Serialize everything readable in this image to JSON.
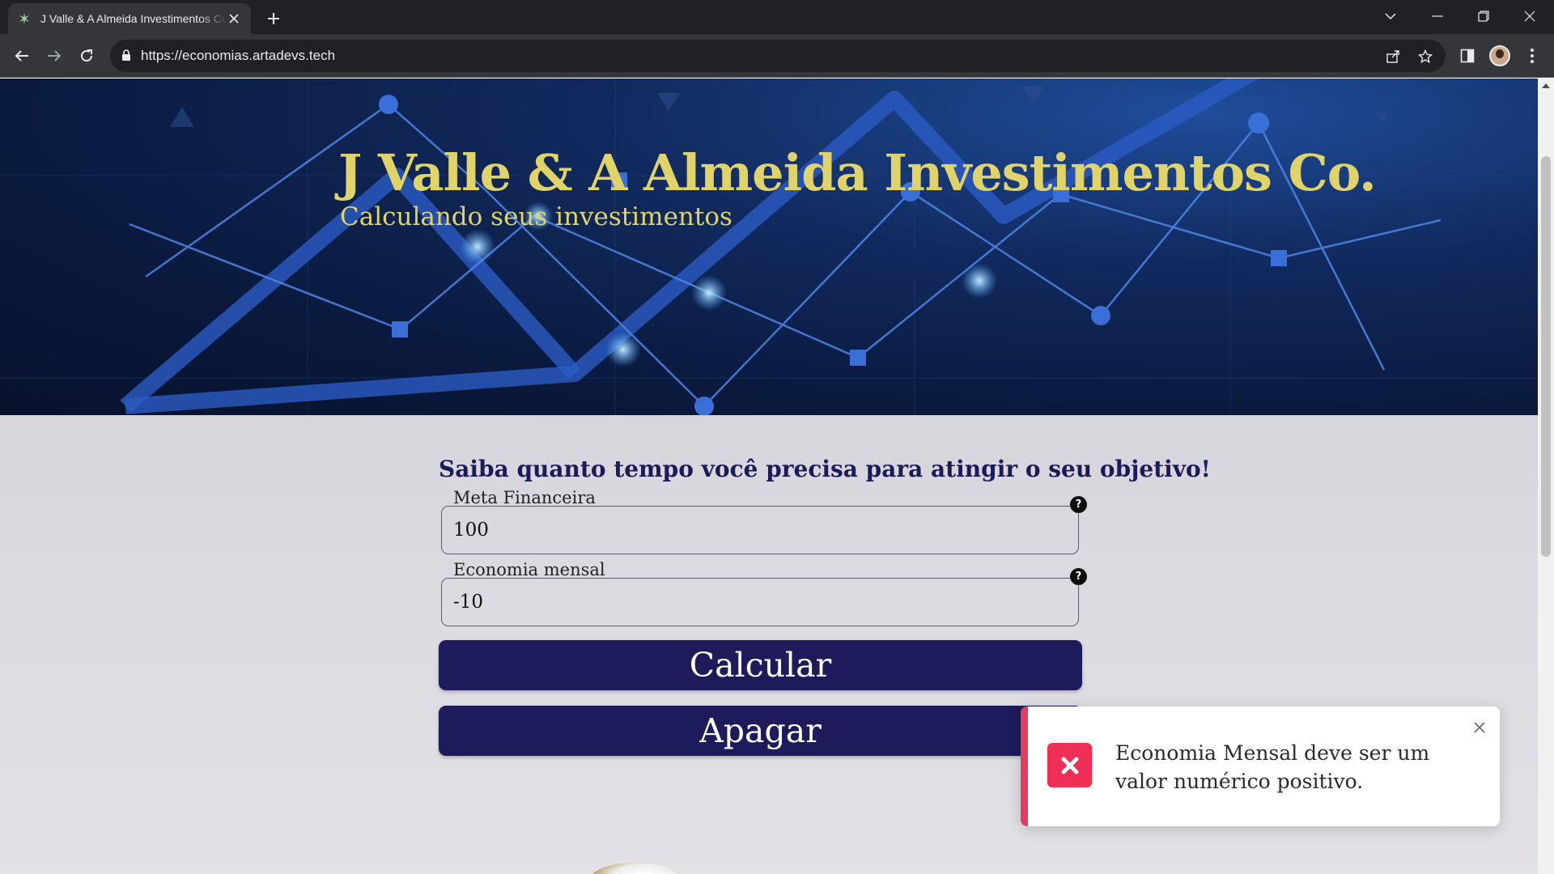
{
  "browser": {
    "tab_title": "J Valle & A Almeida Investimentos Co.",
    "url": "https://economias.artadevs.tech"
  },
  "hero": {
    "title": "J Valle & A Almeida Investimentos Co.",
    "subtitle": "Calculando seus investimentos"
  },
  "form": {
    "heading": "Saiba quanto tempo você precisa para atingir o seu objetivo!",
    "meta_label": "Meta Financeira",
    "meta_value": "100",
    "economia_label": "Economia mensal",
    "economia_value": "-10",
    "help_glyph": "?",
    "calcular_label": "Calcular",
    "apagar_label": "Apagar"
  },
  "toast": {
    "message": "Economia Mensal deve ser um valor numérico positivo.",
    "accent_color": "#e23d5f",
    "icon": "error-x-icon"
  },
  "colors": {
    "brand_gold": "#e0d36a",
    "button_navy": "#1e1b5b",
    "heading_navy": "#1c1b5a"
  }
}
